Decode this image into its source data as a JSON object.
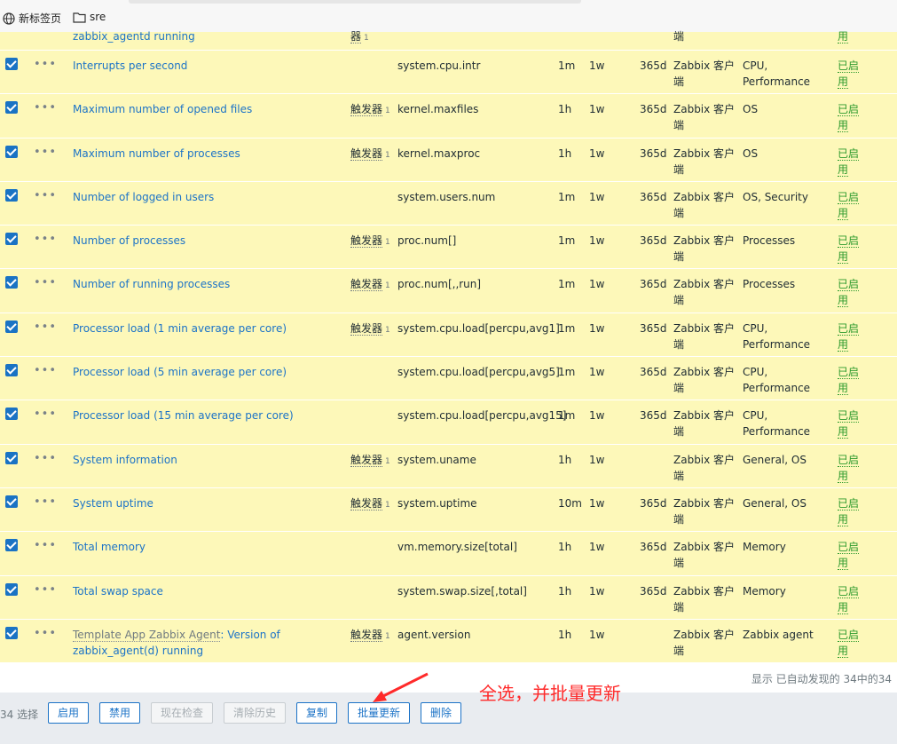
{
  "bookmarks": [
    {
      "icon": "globe-icon",
      "label": "新标签页"
    },
    {
      "icon": "folder-icon",
      "label": "sre"
    }
  ],
  "partial_row": {
    "name": "zabbix_agentd running",
    "trigger_suffix": "器",
    "trigger_count": "1",
    "type_suffix": "端",
    "status_suffix": "用"
  },
  "rows": [
    {
      "name": "Interrupts per second",
      "trigger": "",
      "count": "",
      "key": "system.cpu.intr",
      "interval": "1m",
      "history": "1w",
      "trends": "365d",
      "type": "Zabbix 客户端",
      "apps": "CPU, Performance",
      "status": "已启用"
    },
    {
      "name": "Maximum number of opened files",
      "trigger": "触发器",
      "count": "1",
      "key": "kernel.maxfiles",
      "interval": "1h",
      "history": "1w",
      "trends": "365d",
      "type": "Zabbix 客户端",
      "apps": "OS",
      "status": "已启用"
    },
    {
      "name": "Maximum number of processes",
      "trigger": "触发器",
      "count": "1",
      "key": "kernel.maxproc",
      "interval": "1h",
      "history": "1w",
      "trends": "365d",
      "type": "Zabbix 客户端",
      "apps": "OS",
      "status": "已启用"
    },
    {
      "name": "Number of logged in users",
      "trigger": "",
      "count": "",
      "key": "system.users.num",
      "interval": "1m",
      "history": "1w",
      "trends": "365d",
      "type": "Zabbix 客户端",
      "apps": "OS, Security",
      "status": "已启用"
    },
    {
      "name": "Number of processes",
      "trigger": "触发器",
      "count": "1",
      "key": "proc.num[]",
      "interval": "1m",
      "history": "1w",
      "trends": "365d",
      "type": "Zabbix 客户端",
      "apps": "Processes",
      "status": "已启用"
    },
    {
      "name": "Number of running processes",
      "trigger": "触发器",
      "count": "1",
      "key": "proc.num[,,run]",
      "interval": "1m",
      "history": "1w",
      "trends": "365d",
      "type": "Zabbix 客户端",
      "apps": "Processes",
      "status": "已启用"
    },
    {
      "name": "Processor load (1 min average per core)",
      "trigger": "触发器",
      "count": "1",
      "key": "system.cpu.load[percpu,avg1]",
      "interval": "1m",
      "history": "1w",
      "trends": "365d",
      "type": "Zabbix 客户端",
      "apps": "CPU, Performance",
      "status": "已启用"
    },
    {
      "name": "Processor load (5 min average per core)",
      "trigger": "",
      "count": "",
      "key": "system.cpu.load[percpu,avg5]",
      "interval": "1m",
      "history": "1w",
      "trends": "365d",
      "type": "Zabbix 客户端",
      "apps": "CPU, Performance",
      "status": "已启用"
    },
    {
      "name": "Processor load (15 min average per core)",
      "trigger": "",
      "count": "",
      "key": "system.cpu.load[percpu,avg15]",
      "interval": "1m",
      "history": "1w",
      "trends": "365d",
      "type": "Zabbix 客户端",
      "apps": "CPU, Performance",
      "status": "已启用"
    },
    {
      "name": "System information",
      "trigger": "触发器",
      "count": "1",
      "key": "system.uname",
      "interval": "1h",
      "history": "1w",
      "trends": "",
      "type": "Zabbix 客户端",
      "apps": "General, OS",
      "status": "已启用"
    },
    {
      "name": "System uptime",
      "trigger": "触发器",
      "count": "1",
      "key": "system.uptime",
      "interval": "10m",
      "history": "1w",
      "trends": "365d",
      "type": "Zabbix 客户端",
      "apps": "General, OS",
      "status": "已启用"
    },
    {
      "name": "Total memory",
      "trigger": "",
      "count": "",
      "key": "vm.memory.size[total]",
      "interval": "1h",
      "history": "1w",
      "trends": "365d",
      "type": "Zabbix 客户端",
      "apps": "Memory",
      "status": "已启用"
    },
    {
      "name": "Total swap space",
      "trigger": "",
      "count": "",
      "key": "system.swap.size[,total]",
      "interval": "1h",
      "history": "1w",
      "trends": "365d",
      "type": "Zabbix 客户端",
      "apps": "Memory",
      "status": "已启用"
    },
    {
      "name_prefix": "Template App Zabbix Agent",
      "name": ": Version of zabbix_agent(d) running",
      "trigger": "触发器",
      "count": "1",
      "key": "agent.version",
      "interval": "1h",
      "history": "1w",
      "trends": "",
      "type": "Zabbix 客户端",
      "apps": "Zabbix agent",
      "status": "已启用"
    }
  ],
  "summary": "显示 已自动发现的 34中的34",
  "footer": {
    "selected": "34 选择",
    "buttons": [
      {
        "label": "启用",
        "disabled": false
      },
      {
        "label": "禁用",
        "disabled": false
      },
      {
        "label": "现在检查",
        "disabled": true
      },
      {
        "label": "清除历史",
        "disabled": true
      },
      {
        "label": "复制",
        "disabled": false
      },
      {
        "label": "批量更新",
        "disabled": false
      },
      {
        "label": "删除",
        "disabled": false
      }
    ]
  },
  "annotation": "全选，并批量更新",
  "colors": {
    "row_bg": "#fdf8b9",
    "link": "#1c73c7",
    "enabled": "#2d9a2d",
    "annotation": "#ff2a2a"
  }
}
